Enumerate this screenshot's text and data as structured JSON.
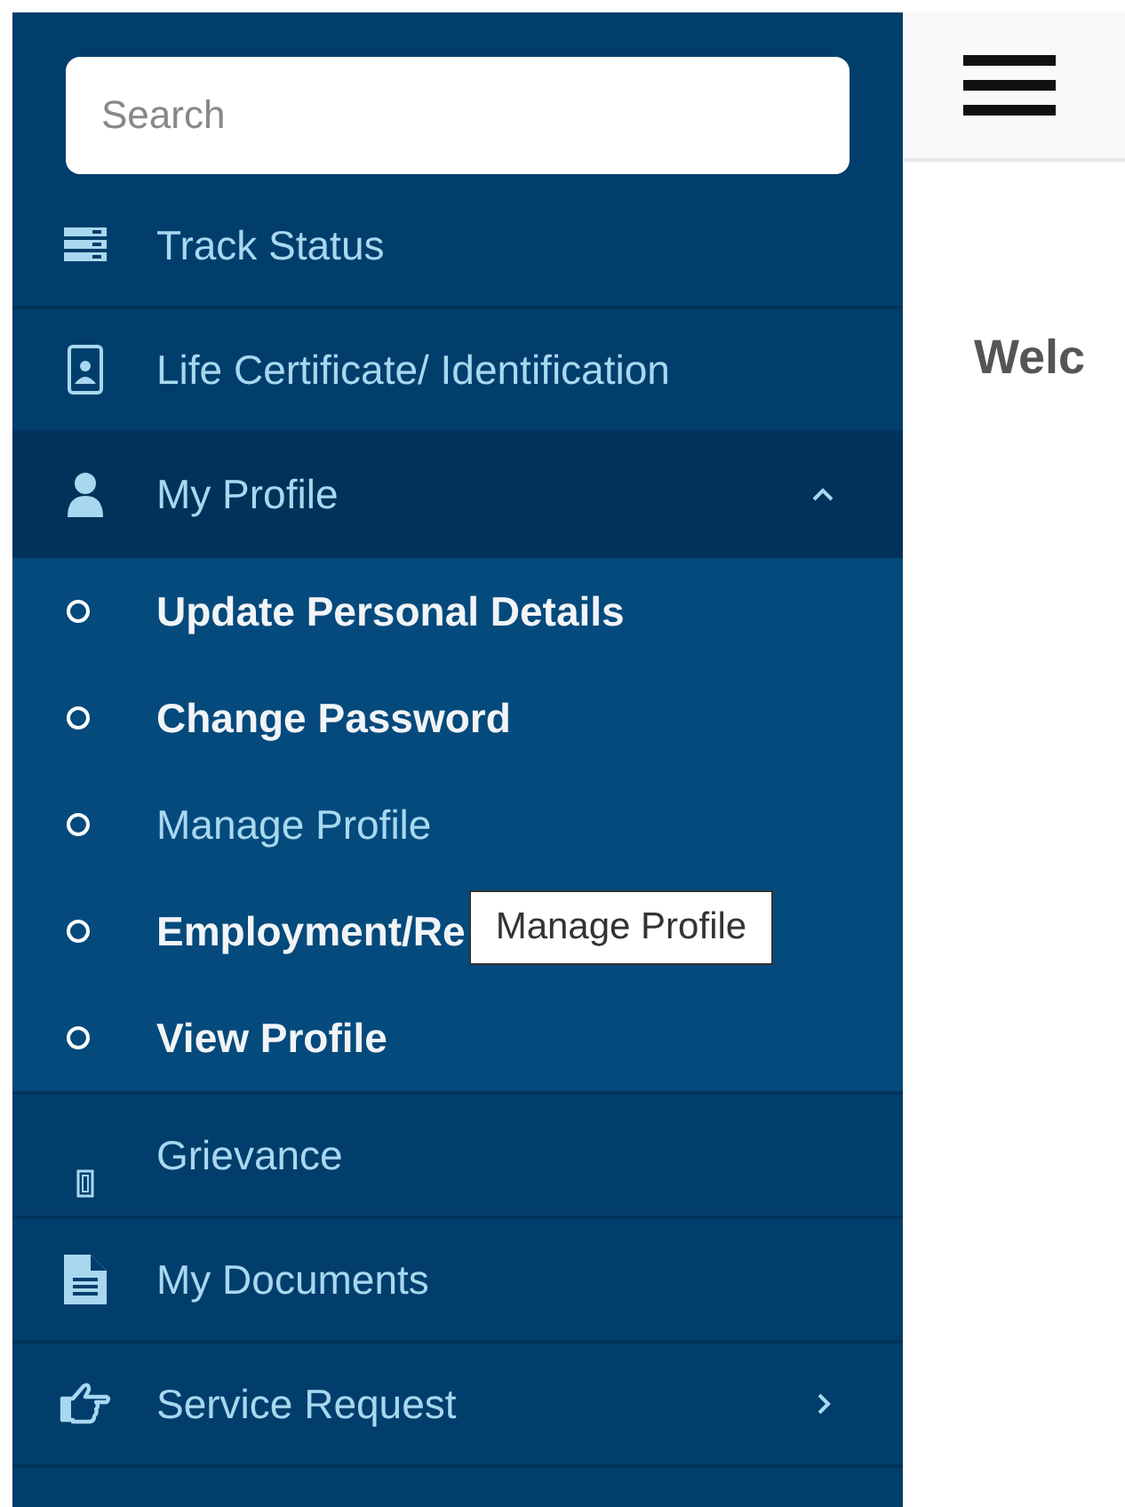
{
  "sidebar": {
    "search": {
      "placeholder": "Search"
    },
    "items": [
      {
        "label": "Track Status",
        "selected": false
      },
      {
        "label": "Life Certificate/ Identification",
        "selected": false
      },
      {
        "label": "My Profile",
        "expanded": true,
        "selected": true,
        "children": [
          {
            "label": "Update Personal Details",
            "selected": false
          },
          {
            "label": "Change Password",
            "selected": false
          },
          {
            "label": "Manage Profile",
            "selected": true
          },
          {
            "label": "Employment/Re",
            "selected": false,
            "tooltip": "Manage Profile"
          },
          {
            "label": "View Profile",
            "selected": false
          }
        ]
      },
      {
        "label": "Grievance",
        "selected": false
      },
      {
        "label": "My Documents",
        "selected": false
      },
      {
        "label": "Service Request",
        "expanded": false,
        "selected": false
      }
    ]
  },
  "main": {
    "heading": "Welc"
  }
}
